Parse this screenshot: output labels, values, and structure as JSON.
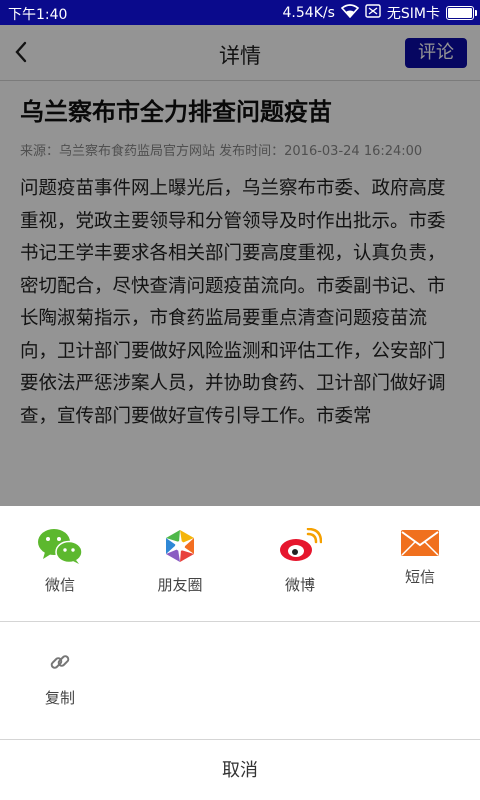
{
  "status_bar": {
    "time": "下午1:40",
    "speed": "4.54K/s",
    "sim": "无SIM卡",
    "battery_level": 1.0
  },
  "app_bar": {
    "title": "详情",
    "comment_label": "评论",
    "back_icon": "chevron-left-icon"
  },
  "article": {
    "title": "乌兰察布市全力排查问题疫苗",
    "meta": "来源：乌兰察布食药监局官方网站 发布时间：2016-03-24 16:24:00",
    "body": "问题疫苗事件网上曝光后，乌兰察布市委、政府高度重视，党政主要领导和分管领导及时作出批示。市委书记王学丰要求各相关部门要高度重视，认真负责，密切配合，尽快查清问题疫苗流向。市委副书记、市长陶淑菊指示，市食药监局要重点清查问题疫苗流向，卫计部门要做好风险监测和评估工作，公安部门要依法严惩涉案人员，并协助食药、卫计部门做好调查，宣传部门要做好宣传引导工作。市委常"
  },
  "share_sheet": {
    "items": [
      {
        "label": "微信",
        "icon": "wechat-icon"
      },
      {
        "label": "朋友圈",
        "icon": "moments-icon"
      },
      {
        "label": "微博",
        "icon": "weibo-icon"
      },
      {
        "label": "短信",
        "icon": "sms-icon"
      }
    ],
    "copy_label": "复制",
    "copy_icon": "link-icon",
    "cancel_label": "取消"
  },
  "colors": {
    "status_bar": "#0a0a8c",
    "comment_button": "#0b0ba8",
    "wechat_green": "#5cb82e",
    "weibo_red": "#e6162d",
    "sms_orange": "#f0701e"
  }
}
